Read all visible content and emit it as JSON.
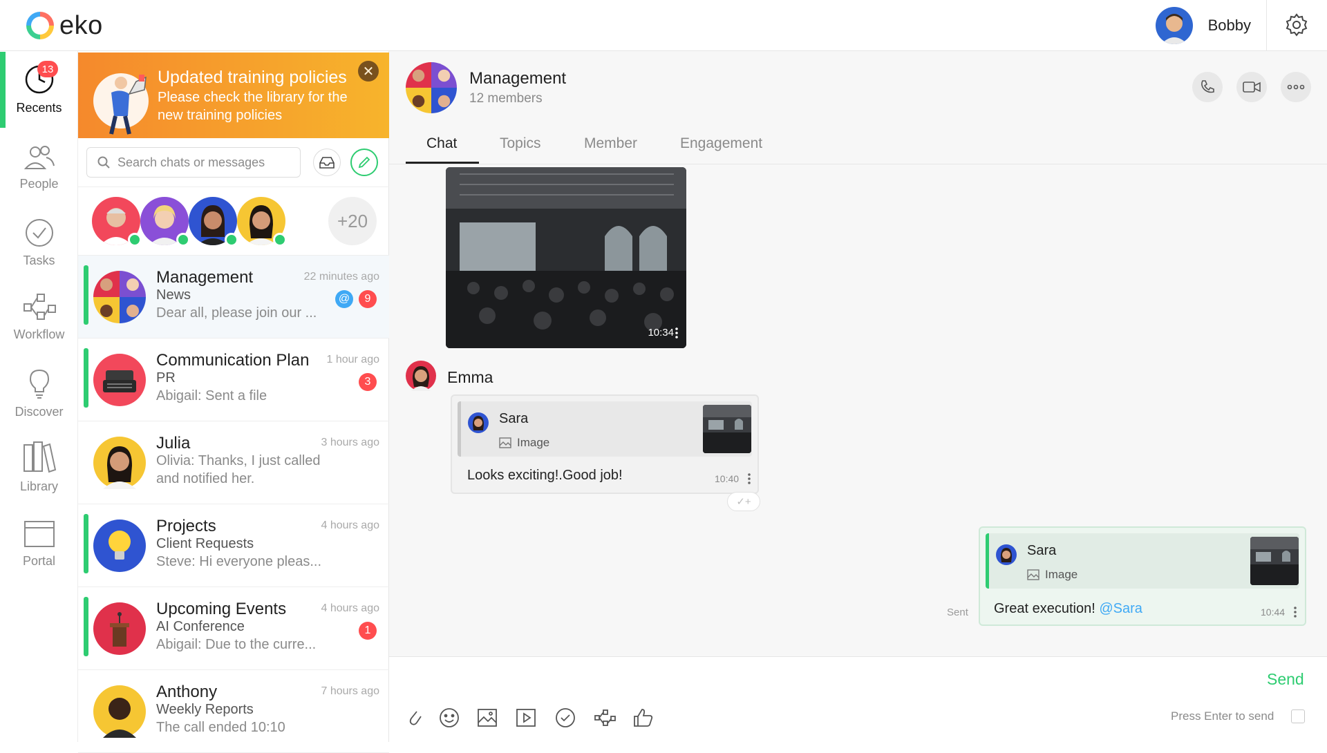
{
  "app": {
    "logo_text": "eko",
    "accent_color": "#2ecc71",
    "badge_color": "#ff4d4f"
  },
  "header": {
    "user_name": "Bobby",
    "settings_icon": "gear-icon"
  },
  "nav": {
    "recents_badge": "13",
    "items": [
      {
        "label": "Recents",
        "icon": "clock-icon"
      },
      {
        "label": "People",
        "icon": "people-icon"
      },
      {
        "label": "Tasks",
        "icon": "check-circle-icon"
      },
      {
        "label": "Workflow",
        "icon": "workflow-icon"
      },
      {
        "label": "Discover",
        "icon": "lightbulb-icon"
      },
      {
        "label": "Library",
        "icon": "books-icon"
      },
      {
        "label": "Portal",
        "icon": "browser-window-icon"
      }
    ]
  },
  "banner": {
    "title": "Updated training policies",
    "body": "Please check the library for the new training policies",
    "close": "✕"
  },
  "search": {
    "placeholder": "Search chats or messages"
  },
  "stories": {
    "more": "+20"
  },
  "chats": [
    {
      "title": "Management",
      "subtitle": "News",
      "preview": "Dear all, please join our ...",
      "time": "22 minutes ago",
      "badge": "9",
      "mention": "@"
    },
    {
      "title": "Communication Plan",
      "subtitle": "PR",
      "preview": "Abigail: Sent a file",
      "time": "1 hour ago",
      "badge": "3"
    },
    {
      "title": "Julia",
      "subtitle": "Olivia: Thanks, I just called",
      "preview": "and notified her.",
      "time": "3 hours ago"
    },
    {
      "title": "Projects",
      "subtitle": "Client Requests",
      "preview": "Steve: Hi everyone pleas...",
      "time": "4 hours ago"
    },
    {
      "title": "Upcoming Events",
      "subtitle": "AI Conference",
      "preview": "Abigail: Due to the curre...",
      "time": "4 hours ago",
      "badge": "1"
    },
    {
      "title": "Anthony",
      "subtitle": "Weekly Reports",
      "preview": "The call ended 10:10",
      "time": "7 hours ago"
    }
  ],
  "conversation": {
    "name": "Management",
    "members": "12 members",
    "tabs": [
      "Chat",
      "Topics",
      "Member",
      "Engagement"
    ],
    "image_time": "10:34",
    "sender": "Emma",
    "reply1": {
      "quote_name": "Sara",
      "quote_label": "Image",
      "text": "Looks exciting!.Good job!",
      "time": "10:40"
    },
    "reply2": {
      "quote_name": "Sara",
      "quote_label": "Image",
      "text": "Great execution! ",
      "mention": "@Sara",
      "time": "10:44"
    },
    "sent_label": "Sent",
    "reaction": "✓+"
  },
  "composer": {
    "send": "Send",
    "enter_hint": "Press Enter to send"
  }
}
